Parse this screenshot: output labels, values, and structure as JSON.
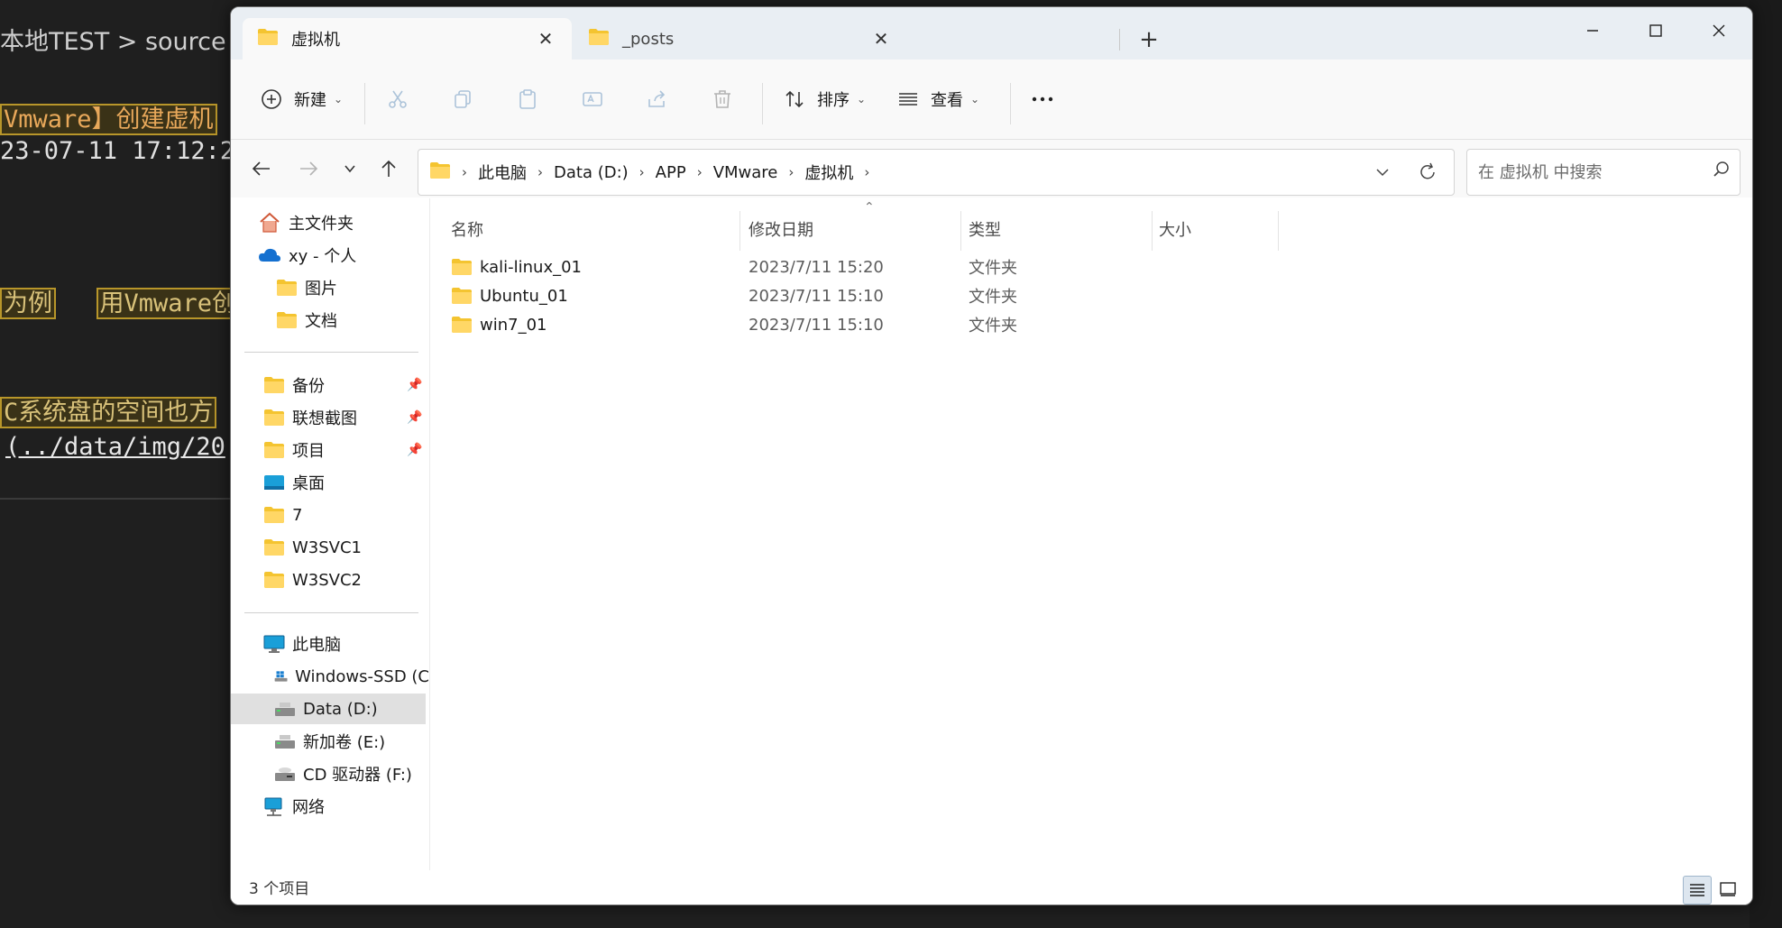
{
  "background_editor": {
    "breadcrumb": "本地TEST > source >",
    "lines": [
      "Vmware】创建虚机",
      "23-07-11 17:12:2",
      "为例",
      "用Vmware创建",
      "C系统盘的空间也方",
      "(../data/img/20"
    ]
  },
  "tabs": [
    {
      "label": "虚拟机",
      "active": true
    },
    {
      "label": "_posts",
      "active": false
    }
  ],
  "toolbar": {
    "new_label": "新建",
    "sort_label": "排序",
    "view_label": "查看"
  },
  "address": {
    "crumbs": [
      "此电脑",
      "Data (D:)",
      "APP",
      "VMware",
      "虚拟机"
    ]
  },
  "search": {
    "placeholder": "在 虚拟机 中搜索"
  },
  "sidebar": {
    "items": [
      {
        "label": "主文件夹",
        "icon": "home-icon"
      },
      {
        "label": "xy - 个人",
        "icon": "onedrive-cloud-icon"
      },
      {
        "label": "图片",
        "icon": "folder-icon"
      },
      {
        "label": "文档",
        "icon": "folder-icon"
      },
      {
        "label": "备份",
        "icon": "folder-icon",
        "pinned": true
      },
      {
        "label": "联想截图",
        "icon": "folder-icon",
        "pinned": true
      },
      {
        "label": "项目",
        "icon": "folder-icon",
        "pinned": true
      },
      {
        "label": "桌面",
        "icon": "desktop-icon"
      },
      {
        "label": "7",
        "icon": "folder-icon"
      },
      {
        "label": "W3SVC1",
        "icon": "folder-icon"
      },
      {
        "label": "W3SVC2",
        "icon": "folder-icon"
      },
      {
        "label": "此电脑",
        "icon": "computer-icon"
      },
      {
        "label": "Windows-SSD (C",
        "icon": "windows-drive-icon"
      },
      {
        "label": "Data (D:)",
        "icon": "drive-icon",
        "selected": true
      },
      {
        "label": "新加卷 (E:)",
        "icon": "drive-icon"
      },
      {
        "label": "CD 驱动器 (F:)",
        "icon": "cd-drive-icon"
      },
      {
        "label": "网络",
        "icon": "network-icon"
      }
    ]
  },
  "columns": {
    "name": "名称",
    "modified": "修改日期",
    "type": "类型",
    "size": "大小"
  },
  "files": [
    {
      "name": "kali-linux_01",
      "modified": "2023/7/11 15:20",
      "type": "文件夹",
      "size": ""
    },
    {
      "name": "Ubuntu_01",
      "modified": "2023/7/11 15:10",
      "type": "文件夹",
      "size": ""
    },
    {
      "name": "win7_01",
      "modified": "2023/7/11 15:10",
      "type": "文件夹",
      "size": ""
    }
  ],
  "status": {
    "item_count": "3 个项目"
  },
  "colors": {
    "folder": "#f4c430",
    "accent": "#0067c0",
    "selected_bg": "#e0e0e0"
  }
}
